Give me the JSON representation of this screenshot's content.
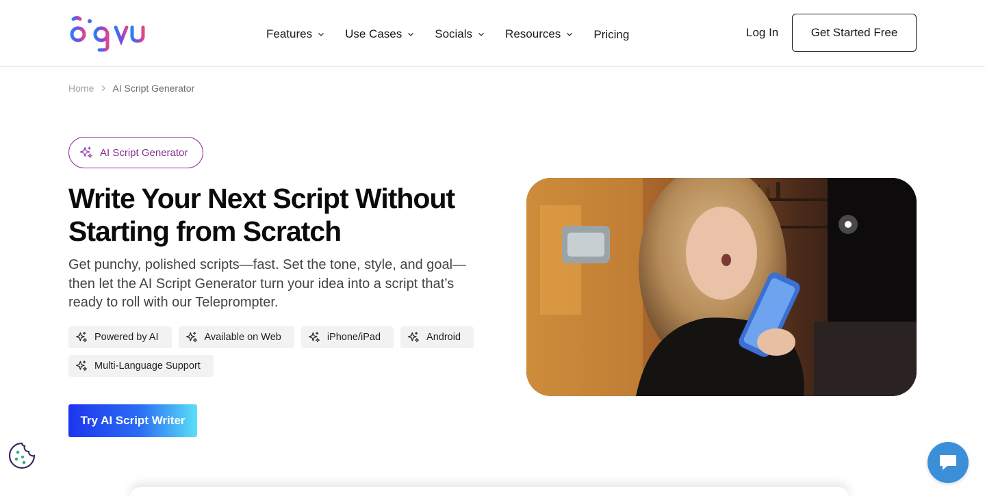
{
  "header": {
    "logo_text": "biqvu",
    "nav": [
      {
        "label": "Features",
        "has_dropdown": true
      },
      {
        "label": "Use Cases",
        "has_dropdown": true
      },
      {
        "label": "Socials",
        "has_dropdown": true
      },
      {
        "label": "Resources",
        "has_dropdown": true
      },
      {
        "label": "Pricing",
        "has_dropdown": false
      }
    ],
    "login_label": "Log In",
    "cta_label": "Get Started Free"
  },
  "breadcrumb": {
    "home": "Home",
    "current": "AI Script Generator"
  },
  "hero": {
    "pill_label": "AI Script Generator",
    "headline": "Write Your Next Script Without Starting from Scratch",
    "subtext": "Get punchy, polished scripts—fast. Set the tone, style, and goal—then let the AI Script Generator turn your idea into a script that’s ready to roll with our Teleprompter.",
    "tags": [
      "Powered by AI",
      "Available on Web",
      "iPhone/iPad",
      "Android",
      "Multi-Language Support"
    ],
    "cta_label": "Try AI Script Writer"
  },
  "colors": {
    "accent_purple": "#8b2f8f",
    "cta_gradient_start": "#1e35ee",
    "cta_gradient_end": "#5ae0f6",
    "chat_blue": "#3b8fd9"
  },
  "icons": {
    "sparkle": "sparkle-icon",
    "chevron": "chevron-down-icon",
    "cookie": "cookie-icon",
    "chat": "chat-icon"
  }
}
